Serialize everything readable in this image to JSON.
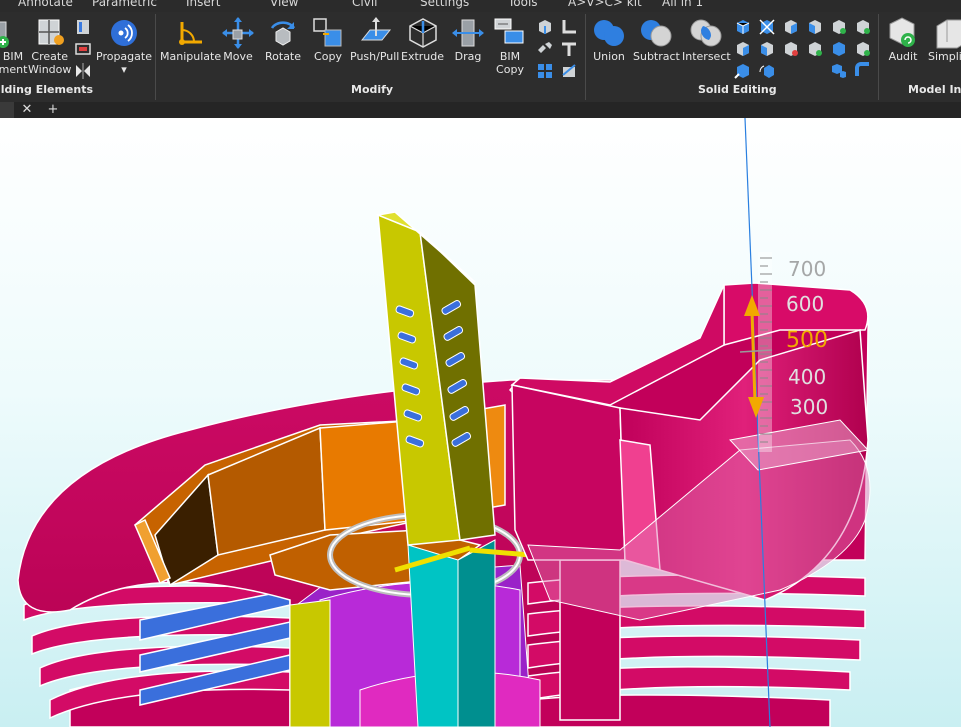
{
  "menu": {
    "items": [
      "Annotate",
      "Parametric",
      "Insert",
      "View",
      "Civil",
      "Settings",
      "Tools",
      "A>V>C> kit",
      "All in 1"
    ]
  },
  "ribbon": {
    "groups": {
      "building_elements": "ilding Elements",
      "modify": "Modify",
      "solid_editing": "Solid Editing",
      "model_integrity": "Model Int"
    },
    "tools": {
      "bim_element": [
        "BIM",
        "ment"
      ],
      "create_window": [
        "Create",
        "Window"
      ],
      "propagate": "Propagate",
      "manipulate": "Manipulate",
      "move": "Move",
      "rotate": "Rotate",
      "copy": "Copy",
      "push_pull": "Push/Pull",
      "extrude": "Extrude",
      "drag": "Drag",
      "bim_copy": [
        "BIM",
        "Copy"
      ],
      "union": "Union",
      "subtract": "Subtract",
      "intersect": "Intersect",
      "audit": "Audit",
      "simplify": "Simplify"
    }
  },
  "doc_tabs": {
    "close_glyph": "✕",
    "add_glyph": "+"
  },
  "viewport": {
    "dimension_ticks": [
      "700",
      "600",
      "500",
      "400",
      "300"
    ],
    "active_tick": "500",
    "colors": {
      "magenta": "#c8005f",
      "olive": "#c8c800",
      "orange": "#e87a00",
      "teal": "#00c4c4",
      "blue": "#3a6fdc",
      "purple": "#9a22c8",
      "gizmo": "#f2a900"
    }
  }
}
